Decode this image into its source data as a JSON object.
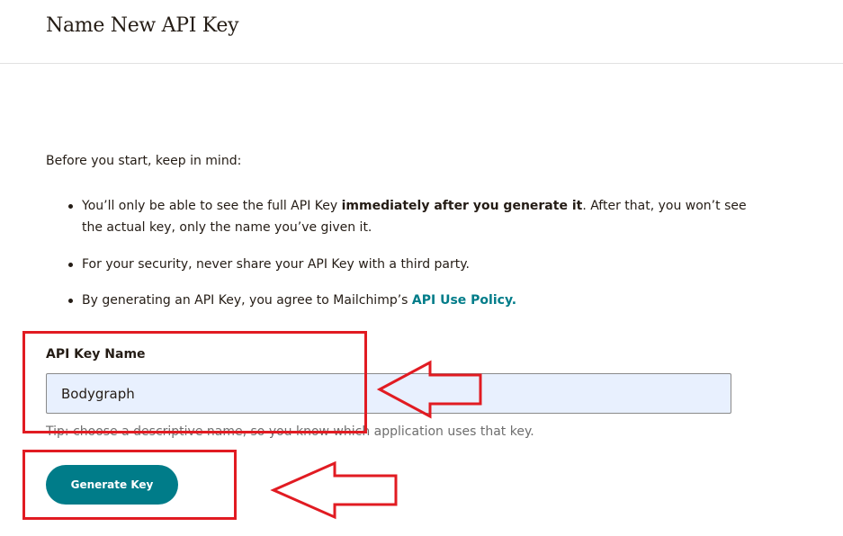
{
  "header": {
    "title": "Name New API Key"
  },
  "intro": {
    "text": "Before you start, keep in mind:"
  },
  "bullets": {
    "item1": {
      "before": "You’ll only be able to see the full API Key ",
      "bold": "immediately after you generate it",
      "after": ". After that, you won’t see the actual key, only the name you’ve given it."
    },
    "item2": {
      "text": "For your security, never share your API Key with a third party."
    },
    "item3": {
      "before": "By generating an API Key, you agree to Mailchimp’s ",
      "link": "API Use Policy",
      "after": "."
    }
  },
  "form": {
    "label": "API Key Name",
    "value": "Bodygraph",
    "tip": "Tip: choose a descriptive name, so you know which application uses that key."
  },
  "actions": {
    "generate_label": "Generate Key"
  },
  "colors": {
    "accent": "#007c89",
    "input_fill": "#e8f0fe",
    "annotation": "#e11b22"
  },
  "annotations": {
    "icons": [
      "arrow-left-icon",
      "arrow-left-icon"
    ]
  }
}
